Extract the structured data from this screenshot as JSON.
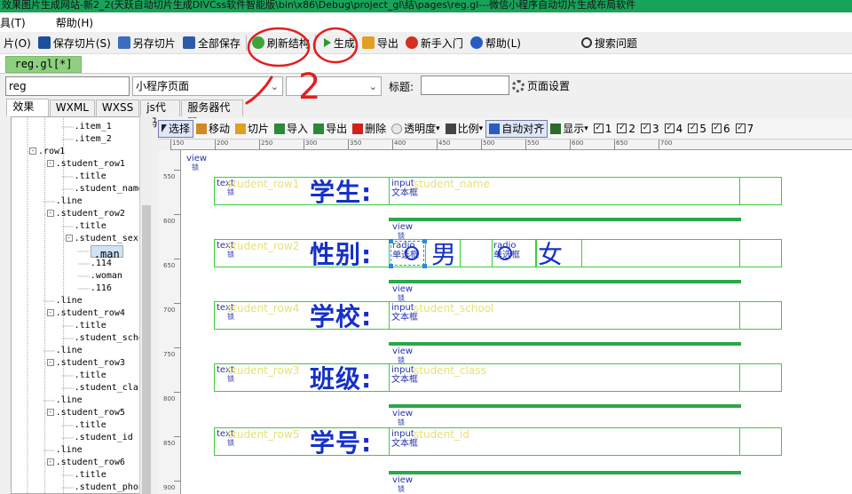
{
  "window": {
    "title": "效果图片生成网站-新2_2(天跃自动切片生成DIVCss软件智能版\\bin\\x86\\Debug\\project_gl\\结\\pages\\reg.gl---微信小程序自动切片生成布局软件"
  },
  "menu": {
    "items": [
      "具(T)",
      "帮助(H)"
    ]
  },
  "toolbar": {
    "items": [
      {
        "label": "片(O)",
        "name": "open-slice-button",
        "icon": "folder-icon",
        "color": ""
      },
      {
        "label": "保存切片(S)",
        "name": "save-slice-button",
        "icon": "save-icon",
        "color": "#1c4f9c"
      },
      {
        "label": "另存切片",
        "name": "save-as-slice-button",
        "icon": "save-as-icon",
        "color": "#3a6fc0"
      },
      {
        "label": "全部保存",
        "name": "save-all-button",
        "icon": "save-all-icon",
        "color": "#2c5aa8"
      },
      {
        "label": "刷新结构",
        "name": "refresh-structure-button",
        "icon": "refresh-icon",
        "color": "#3aa53a"
      },
      {
        "label": "生成",
        "name": "generate-button",
        "icon": "play-icon",
        "color": "#2a9a2a"
      },
      {
        "label": "导出",
        "name": "export-button",
        "icon": "folder-open-icon",
        "color": "#e0a020"
      },
      {
        "label": "新手入门",
        "name": "beginner-guide-button",
        "icon": "lifebuoy-icon",
        "color": "#d23020"
      },
      {
        "label": "帮助(L)",
        "name": "help-button",
        "icon": "help-icon",
        "color": "#2a5cc0"
      },
      {
        "label": "搜索问题",
        "name": "search-problem-button",
        "icon": "search-icon",
        "color": "#333333"
      }
    ]
  },
  "doc_tab": {
    "label": "reg.gl[*]"
  },
  "props": {
    "page_name": "reg",
    "page_type": "小程序页面",
    "second_select": "",
    "title_label": "标题:",
    "title_value": "",
    "page_settings": "页面设置"
  },
  "view_tabs": [
    "效果图",
    "WXML",
    "WXSS",
    "js代码",
    "服务器代码"
  ],
  "tree": [
    {
      "t": ".item_1",
      "d": 3,
      "toggle": ""
    },
    {
      "t": ".item_2",
      "d": 3,
      "toggle": ""
    },
    {
      "t": ".row1",
      "d": 1,
      "toggle": "-"
    },
    {
      "t": ".student_row1",
      "d": 2,
      "toggle": "-"
    },
    {
      "t": ".title",
      "d": 3,
      "toggle": ""
    },
    {
      "t": ".student_name",
      "d": 3,
      "toggle": ""
    },
    {
      "t": ".line",
      "d": 2,
      "toggle": ""
    },
    {
      "t": ".student_row2",
      "d": 2,
      "toggle": "-"
    },
    {
      "t": ".title",
      "d": 3,
      "toggle": ""
    },
    {
      "t": ".student_sex",
      "d": 3,
      "toggle": "-"
    },
    {
      "t": ".man",
      "d": 4,
      "toggle": "",
      "sel": true
    },
    {
      "t": ".114",
      "d": 4,
      "toggle": ""
    },
    {
      "t": ".woman",
      "d": 4,
      "toggle": ""
    },
    {
      "t": ".116",
      "d": 4,
      "toggle": ""
    },
    {
      "t": ".line",
      "d": 2,
      "toggle": ""
    },
    {
      "t": ".student_row4",
      "d": 2,
      "toggle": "-"
    },
    {
      "t": ".title",
      "d": 3,
      "toggle": ""
    },
    {
      "t": ".student_school",
      "d": 3,
      "toggle": ""
    },
    {
      "t": ".line",
      "d": 2,
      "toggle": ""
    },
    {
      "t": ".student_row3",
      "d": 2,
      "toggle": "-"
    },
    {
      "t": ".title",
      "d": 3,
      "toggle": ""
    },
    {
      "t": ".student_class",
      "d": 3,
      "toggle": ""
    },
    {
      "t": ".line",
      "d": 2,
      "toggle": ""
    },
    {
      "t": ".student_row5",
      "d": 2,
      "toggle": "-"
    },
    {
      "t": ".title",
      "d": 3,
      "toggle": ""
    },
    {
      "t": ".student_id",
      "d": 3,
      "toggle": ""
    },
    {
      "t": ".line",
      "d": 2,
      "toggle": ""
    },
    {
      "t": ".student_row6",
      "d": 2,
      "toggle": "-"
    },
    {
      "t": ".title",
      "d": 3,
      "toggle": ""
    },
    {
      "t": ".student_phone",
      "d": 3,
      "toggle": ""
    }
  ],
  "canvas_toolbar": {
    "items": [
      "选择",
      "移动",
      "切片",
      "导入",
      "导出",
      "删除",
      "透明度",
      "比例",
      "自动对齐",
      "显示"
    ],
    "checks": [
      "1",
      "2",
      "3",
      "4",
      "5",
      "6",
      "7"
    ]
  },
  "ruler": {
    "h": [
      "150",
      "200",
      "250",
      "300",
      "350",
      "400",
      "450",
      "500",
      "550",
      "600",
      "650",
      "700"
    ],
    "v": [
      "550",
      "600",
      "650",
      "700",
      "750",
      "800",
      "850",
      "900"
    ]
  },
  "canvas": {
    "view_label": "view",
    "lock_label": "锁",
    "text_label": "text",
    "input_label": "input",
    "textbox_label": "文本框",
    "radio_label": "radio",
    "radio_caption": "单选框",
    "rows": [
      {
        "name": "student_row1",
        "field": "student_name",
        "title": "学生:"
      },
      {
        "name": "student_row2",
        "field": "",
        "title": "性别:"
      },
      {
        "name": "student_row4",
        "field": "student_school",
        "title": "学校:"
      },
      {
        "name": "student_row3",
        "field": "student_class",
        "title": "班级:"
      },
      {
        "name": "student_row5",
        "field": "student_id",
        "title": "学号:"
      }
    ],
    "sex_options": [
      "男",
      "女"
    ]
  },
  "annotations": [
    "2"
  ]
}
